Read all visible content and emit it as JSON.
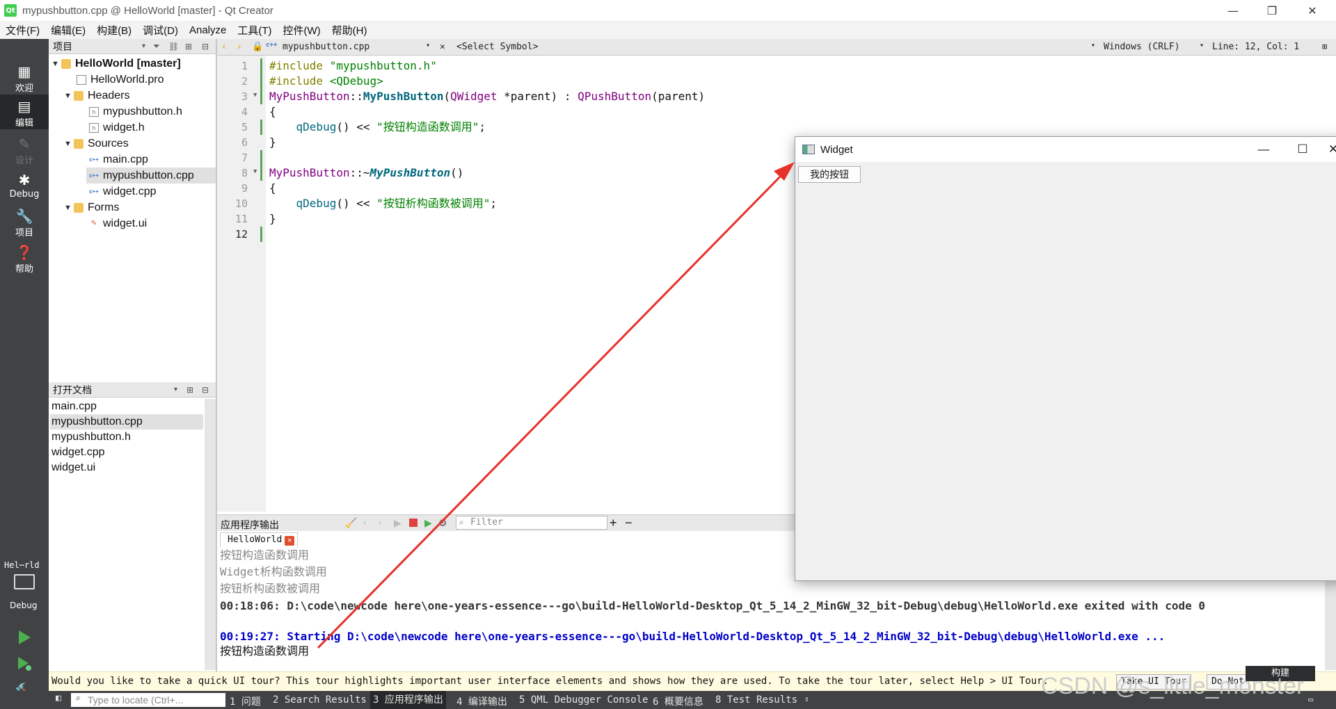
{
  "window": {
    "title": "mypushbutton.cpp @ HelloWorld [master] - Qt Creator"
  },
  "menu": [
    "文件(F)",
    "编辑(E)",
    "构建(B)",
    "调试(D)",
    "Analyze",
    "工具(T)",
    "控件(W)",
    "帮助(H)"
  ],
  "modes": [
    {
      "label": "欢迎",
      "icon": "grid-icon"
    },
    {
      "label": "编辑",
      "icon": "edit-icon"
    },
    {
      "label": "设计",
      "icon": "pencil-icon"
    },
    {
      "label": "Debug",
      "icon": "bug-icon"
    },
    {
      "label": "项目",
      "icon": "wrench-icon"
    },
    {
      "label": "帮助",
      "icon": "help-icon"
    }
  ],
  "kit": {
    "name": "Hel⋯rld",
    "mode": "Debug"
  },
  "projects": {
    "header": "项目",
    "root": "HelloWorld [master]",
    "pro_file": "HelloWorld.pro",
    "headers_label": "Headers",
    "headers": [
      "mypushbutton.h",
      "widget.h"
    ],
    "sources_label": "Sources",
    "sources": [
      "main.cpp",
      "mypushbutton.cpp",
      "widget.cpp"
    ],
    "forms_label": "Forms",
    "forms": [
      "widget.ui"
    ]
  },
  "open_docs": {
    "header": "打开文档",
    "items": [
      "main.cpp",
      "mypushbutton.cpp",
      "mypushbutton.h",
      "widget.cpp",
      "widget.ui"
    ],
    "selected": "mypushbutton.cpp"
  },
  "editor": {
    "file": "mypushbutton.cpp",
    "symbol": "<Select Symbol>",
    "line_ending": "Windows (CRLF)",
    "position": "Line: 12, Col: 1",
    "line_numbers": [
      "1",
      "2",
      "3",
      "4",
      "5",
      "6",
      "7",
      "8",
      "9",
      "10",
      "11",
      "12"
    ],
    "code": {
      "inc1_kw": "#include",
      "inc1_file": " \"mypushbutton.h\"",
      "inc2_kw": "#include",
      "inc2_file": " <QDebug>",
      "l3_a": "MyPushButton",
      "l3_b": "::",
      "l3_c": "MyPushButton",
      "l3_d": "(",
      "l3_e": "QWidget",
      "l3_f": " *parent) : ",
      "l3_g": "QPushButton",
      "l3_h": "(parent)",
      "brace_open": "{",
      "l5_fn": "    qDebug",
      "l5_op": "() << ",
      "l5_str": "\"按钮构造函数调用\"",
      "l5_end": ";",
      "brace_close": "}",
      "l8_a": "MyPushButton",
      "l8_b": "::~",
      "l8_c": "MyPushButton",
      "l8_d": "()",
      "l10_fn": "    qDebug",
      "l10_op": "() << ",
      "l10_str": "\"按钮析构函数被调用\"",
      "l10_end": ";"
    }
  },
  "output": {
    "title": "应用程序输出",
    "filter_placeholder": "Filter",
    "tab": "HelloWorld",
    "lines": {
      "l1": "按钮构造函数调用",
      "l2": "Widget析构函数调用",
      "l3": "按钮析构函数被调用",
      "l4": "00:18:06: D:\\code\\newcode here\\one-years-essence---go\\build-HelloWorld-Desktop_Qt_5_14_2_MinGW_32_bit-Debug\\debug\\HelloWorld.exe exited with code 0",
      "l5": "00:19:27: Starting D:\\code\\newcode here\\one-years-essence---go\\build-HelloWorld-Desktop_Qt_5_14_2_MinGW_32_bit-Debug\\debug\\HelloWorld.exe ...",
      "l6": "按钮构造函数调用"
    }
  },
  "tour": {
    "message": "Would you like to take a quick UI tour? This tour highlights important user interface elements and shows how they are used. To take the tour later, select Help > UI Tour.",
    "take": "Take UI Tour",
    "dont": "Do Not",
    "build_tooltip": "构建"
  },
  "statusbar": {
    "locate_placeholder": "Type to locate (Ctrl+...",
    "tabs": [
      "1 问题",
      "2 Search Results",
      "3 应用程序输出",
      "4 编译输出",
      "5 QML Debugger Console",
      "6 概要信息",
      "8 Test Results"
    ]
  },
  "widget_window": {
    "title": "Widget",
    "button": "我的按钮"
  },
  "watermark": "CSDN @s_little_monster",
  "colors": {
    "accent_arrow": "#e8302a",
    "sidebar": "#404244",
    "output_blue": "#0000c8"
  }
}
